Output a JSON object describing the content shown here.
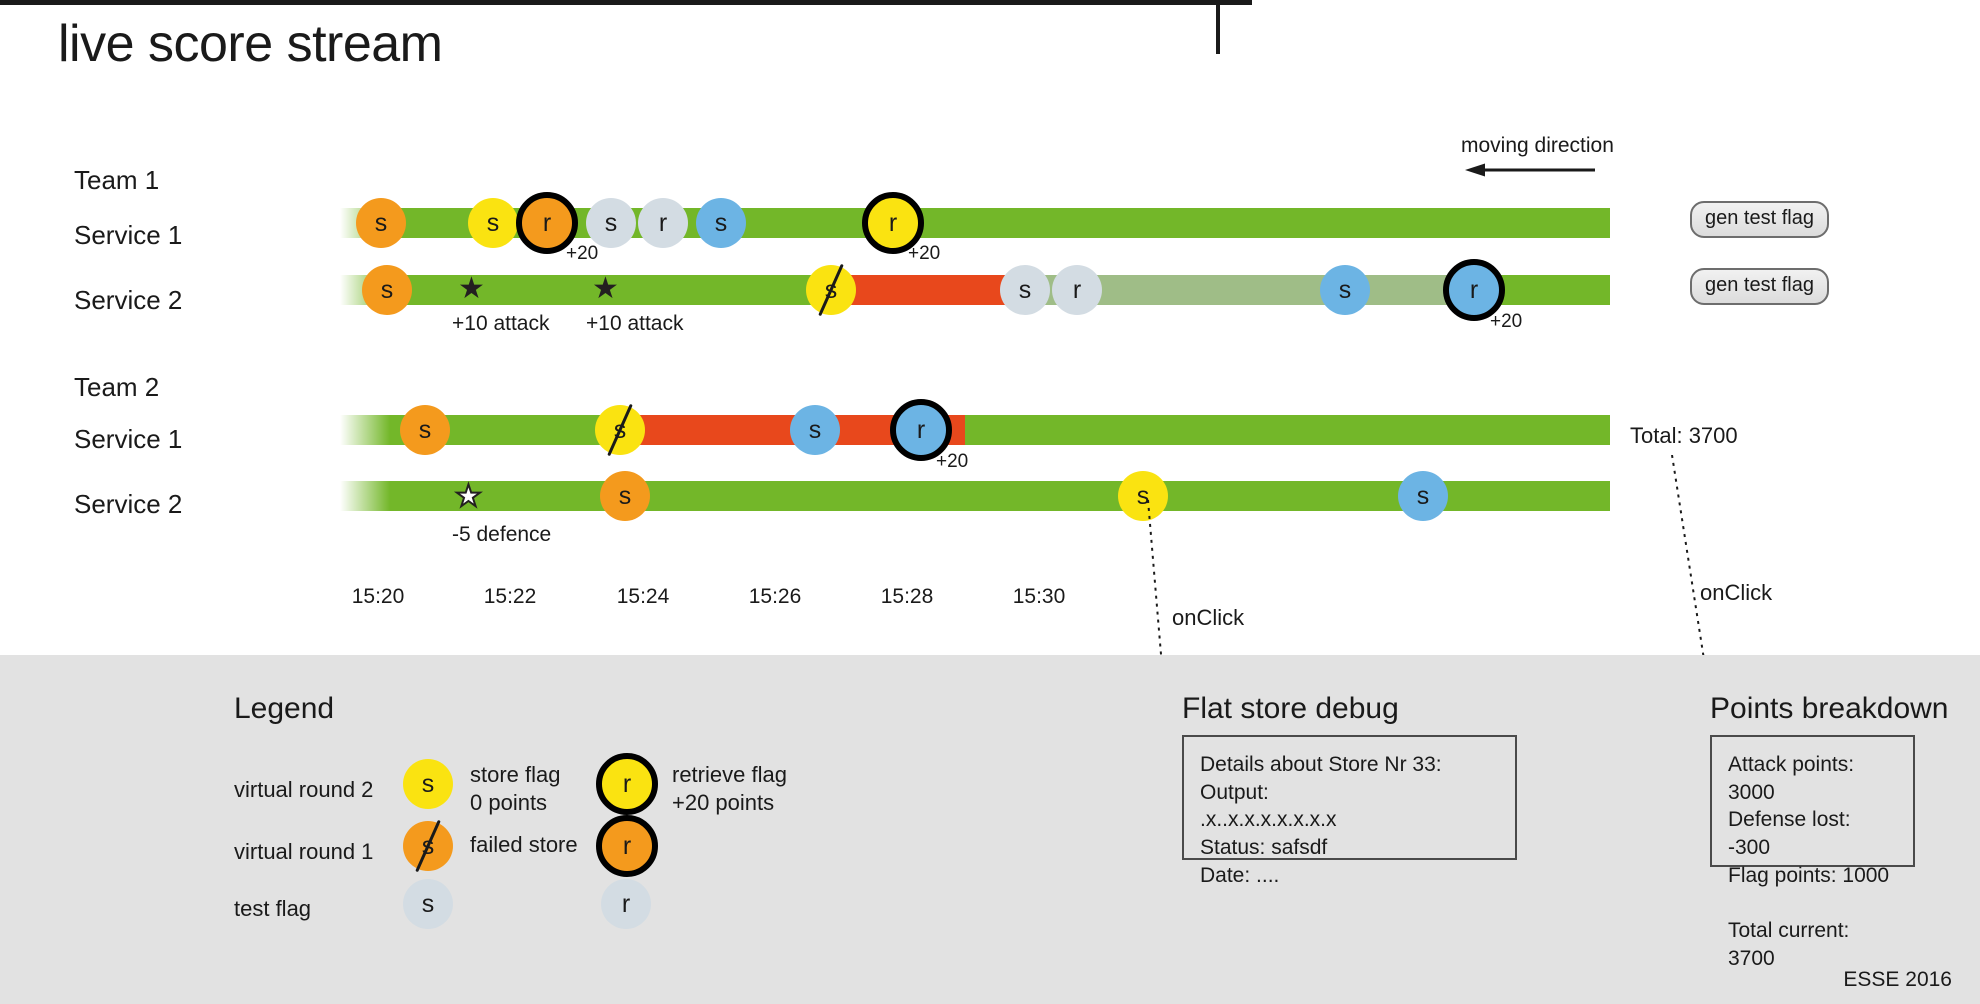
{
  "page": {
    "title": "live score stream",
    "footer": "ESSE 2016",
    "moving_direction_label": "moving direction",
    "total_label": "Total: 3700",
    "onclick_label_flat_store": "onClick",
    "onclick_label_points": "onClick"
  },
  "teams": [
    {
      "name": "Team 1",
      "services": [
        {
          "label": "Service 1",
          "button": "gen test flag"
        },
        {
          "label": "Service 2",
          "button": "gen test flag"
        }
      ]
    },
    {
      "name": "Team 2",
      "services": [
        {
          "label": "Service 1",
          "button": ""
        },
        {
          "label": "Service 2",
          "button": ""
        }
      ]
    }
  ],
  "markers": {
    "t1s1": [
      {
        "glyph": "s",
        "color": "orange",
        "ring": false,
        "strike": false,
        "points": ""
      },
      {
        "glyph": "s",
        "color": "yellow",
        "ring": false,
        "strike": false,
        "points": ""
      },
      {
        "glyph": "r",
        "color": "orange",
        "ring": true,
        "strike": false,
        "points": "+20"
      },
      {
        "glyph": "s",
        "color": "grey",
        "ring": false,
        "strike": false,
        "points": ""
      },
      {
        "glyph": "r",
        "color": "grey",
        "ring": false,
        "strike": false,
        "points": ""
      },
      {
        "glyph": "s",
        "color": "blue",
        "ring": false,
        "strike": false,
        "points": ""
      },
      {
        "glyph": "r",
        "color": "yellow",
        "ring": true,
        "strike": false,
        "points": "+20"
      }
    ],
    "t1s2": [
      {
        "glyph": "s",
        "color": "orange",
        "ring": false,
        "strike": false,
        "points": ""
      },
      {
        "glyph": "s",
        "color": "yellow",
        "ring": false,
        "strike": true,
        "points": ""
      },
      {
        "glyph": "s",
        "color": "grey",
        "ring": false,
        "strike": false,
        "points": ""
      },
      {
        "glyph": "r",
        "color": "grey",
        "ring": false,
        "strike": false,
        "points": ""
      },
      {
        "glyph": "s",
        "color": "blue",
        "ring": false,
        "strike": false,
        "points": ""
      },
      {
        "glyph": "r",
        "color": "blue",
        "ring": true,
        "strike": false,
        "points": "+20"
      }
    ],
    "t2s1": [
      {
        "glyph": "s",
        "color": "orange",
        "ring": false,
        "strike": false,
        "points": ""
      },
      {
        "glyph": "s",
        "color": "yellow",
        "ring": false,
        "strike": true,
        "points": ""
      },
      {
        "glyph": "s",
        "color": "blue",
        "ring": false,
        "strike": false,
        "points": ""
      },
      {
        "glyph": "r",
        "color": "blue",
        "ring": true,
        "strike": false,
        "points": "+20"
      }
    ],
    "t2s2": [
      {
        "glyph": "s",
        "color": "orange",
        "ring": false,
        "strike": false,
        "points": ""
      },
      {
        "glyph": "s",
        "color": "yellow",
        "ring": false,
        "strike": false,
        "points": ""
      },
      {
        "glyph": "s",
        "color": "blue",
        "ring": false,
        "strike": false,
        "points": ""
      }
    ]
  },
  "events": {
    "t1s2_attacks": [
      {
        "symbol": "filled-star",
        "label": "+10 attack"
      },
      {
        "symbol": "filled-star",
        "label": "+10 attack"
      }
    ],
    "t2s2_defence": [
      {
        "symbol": "hollow-star",
        "label": "-5 defence"
      }
    ]
  },
  "time_axis": {
    "ticks": [
      "15:20",
      "15:22",
      "15:24",
      "15:26",
      "15:28",
      "15:30"
    ]
  },
  "legend": {
    "title": "Legend",
    "rows": [
      {
        "round_label": "virtual round 2",
        "store_text": "store flag\n0 points",
        "retrieve_text": "retrieve flag\n+20 points"
      },
      {
        "round_label": "virtual round 1",
        "store_text": "failed store",
        "retrieve_text": ""
      },
      {
        "round_label": "test flag",
        "store_text": "",
        "retrieve_text": ""
      }
    ],
    "samples": {
      "store_round2": {
        "glyph": "s",
        "color": "yellow"
      },
      "retrieve_round2": {
        "glyph": "r",
        "color": "yellow"
      },
      "store_round1": {
        "glyph": "s",
        "color": "orange"
      },
      "retrieve_round1": {
        "glyph": "r",
        "color": "orange"
      },
      "store_test": {
        "glyph": "s",
        "color": "grey"
      },
      "retrieve_test": {
        "glyph": "r",
        "color": "grey"
      }
    }
  },
  "flat_store_debug": {
    "title": "Flat store debug",
    "body": "Details about Store Nr 33:\nOutput:\n.x..x.x.x.x.x.x.x\nStatus: safsdf\nDate: ...."
  },
  "points_breakdown": {
    "title": "Points breakdown",
    "body": "Attack points: 3000\nDefense lost: -300\nFlag points: 1000\n\nTotal current: 3700"
  },
  "colors": {
    "green": "#73b729",
    "red": "#e8481c",
    "muted_green": "#9fbd87",
    "orange": "#f49a1d",
    "yellow": "#fae311",
    "blue": "#6cb4e4",
    "grey": "#d3dce3",
    "panel_bg": "#e2e2e2"
  }
}
